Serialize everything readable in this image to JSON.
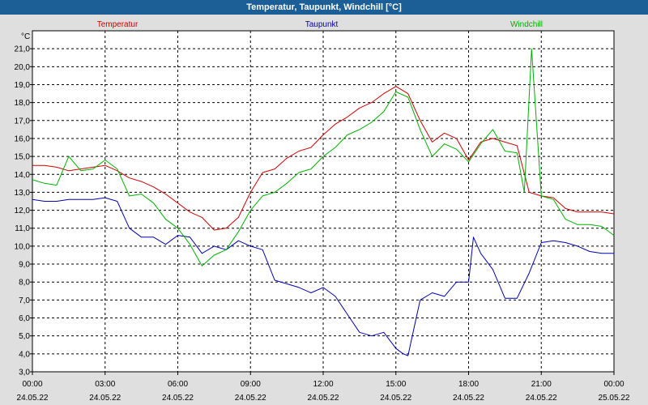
{
  "window": {
    "title": "Temperatur, Taupunkt, Windchill [°C]"
  },
  "chart_data": {
    "type": "line",
    "title": "Temperatur, Taupunkt, Windchill [°C]",
    "ylabel": "°C",
    "ylim": [
      3.0,
      22.0
    ],
    "xlim_hours": [
      0,
      24
    ],
    "grid": true,
    "y_ticks": [
      "3,0",
      "4,0",
      "5,0",
      "6,0",
      "7,0",
      "8,0",
      "9,0",
      "10,0",
      "11,0",
      "12,0",
      "13,0",
      "14,0",
      "15,0",
      "16,0",
      "17,0",
      "18,0",
      "19,0",
      "20,0",
      "21,0"
    ],
    "x_ticks": [
      {
        "time": "00:00",
        "date": "24.05.22"
      },
      {
        "time": "03:00",
        "date": "24.05.22"
      },
      {
        "time": "06:00",
        "date": "24.05.22"
      },
      {
        "time": "09:00",
        "date": "24.05.22"
      },
      {
        "time": "12:00",
        "date": "24.05.22"
      },
      {
        "time": "15:00",
        "date": "24.05.22"
      },
      {
        "time": "18:00",
        "date": "24.05.22"
      },
      {
        "time": "21:00",
        "date": "24.05.22"
      },
      {
        "time": "00:00",
        "date": "25.05.22"
      }
    ],
    "series": [
      {
        "name": "Temperatur",
        "color": "#cc0000",
        "x": [
          0,
          0.5,
          1,
          1.5,
          2,
          2.5,
          3,
          3.5,
          4,
          4.5,
          5,
          5.5,
          6,
          6.5,
          7,
          7.5,
          8,
          8.5,
          9,
          9.5,
          10,
          10.5,
          11,
          11.5,
          12,
          12.5,
          13,
          13.5,
          14,
          14.5,
          15,
          15.5,
          16,
          16.5,
          17,
          17.5,
          18,
          18.5,
          19,
          19.5,
          20,
          20.5,
          21,
          21.5,
          22,
          22.5,
          23,
          23.5,
          24
        ],
        "values": [
          14.5,
          14.5,
          14.4,
          14.2,
          14.3,
          14.4,
          14.5,
          14.2,
          13.8,
          13.6,
          13.3,
          12.9,
          12.4,
          11.9,
          11.6,
          10.9,
          11.0,
          11.6,
          13.0,
          14.1,
          14.3,
          14.9,
          15.3,
          15.5,
          16.2,
          16.8,
          17.2,
          17.7,
          18.0,
          18.5,
          18.9,
          18.5,
          17.0,
          15.8,
          16.3,
          16.0,
          14.8,
          15.8,
          16.0,
          15.8,
          15.6,
          13.0,
          12.8,
          12.7,
          12.1,
          11.9,
          11.9,
          11.9,
          11.8
        ]
      },
      {
        "name": "Taupunkt",
        "color": "#0000b0",
        "x": [
          0,
          0.5,
          1,
          1.5,
          2,
          2.5,
          3,
          3.5,
          4,
          4.5,
          5,
          5.5,
          6,
          6.5,
          7,
          7.5,
          8,
          8.5,
          9,
          9.5,
          10,
          10.5,
          11,
          11.5,
          12,
          12.5,
          13,
          13.5,
          14,
          14.5,
          15,
          15.3,
          15.5,
          16,
          16.5,
          17,
          17.5,
          18,
          18.2,
          18.5,
          19,
          19.5,
          20,
          20.5,
          21,
          21.5,
          22,
          22.5,
          23,
          23.5,
          24
        ],
        "values": [
          12.6,
          12.5,
          12.5,
          12.6,
          12.6,
          12.6,
          12.7,
          12.5,
          11.0,
          10.5,
          10.5,
          10.1,
          10.6,
          10.5,
          9.6,
          10.0,
          9.8,
          10.3,
          10.0,
          9.8,
          8.1,
          7.9,
          7.7,
          7.4,
          7.7,
          7.2,
          6.2,
          5.2,
          5.0,
          5.2,
          4.3,
          4.0,
          3.9,
          7.0,
          7.4,
          7.2,
          8.0,
          8.0,
          10.5,
          9.6,
          8.7,
          7.1,
          7.1,
          8.5,
          10.2,
          10.3,
          10.2,
          10.0,
          9.7,
          9.6,
          9.6
        ]
      },
      {
        "name": "Windchill",
        "color": "#00b000",
        "x": [
          0,
          0.5,
          1,
          1.5,
          2,
          2.5,
          3,
          3.5,
          4,
          4.5,
          5,
          5.5,
          6,
          6.5,
          7,
          7.5,
          8,
          8.5,
          9,
          9.5,
          10,
          10.5,
          11,
          11.5,
          12,
          12.5,
          13,
          13.5,
          14,
          14.5,
          15,
          15.5,
          16,
          16.5,
          17,
          17.5,
          18,
          18.5,
          19,
          19.5,
          20,
          20.3,
          20.6,
          21,
          21.5,
          22,
          22.5,
          23,
          23.5,
          24
        ],
        "values": [
          13.7,
          13.5,
          13.4,
          15.0,
          14.2,
          14.3,
          14.8,
          14.3,
          12.8,
          12.9,
          12.4,
          11.5,
          11.0,
          10.1,
          8.9,
          9.5,
          9.8,
          10.8,
          12.0,
          12.8,
          13.0,
          13.5,
          14.1,
          14.3,
          15.0,
          15.5,
          16.2,
          16.5,
          16.9,
          17.5,
          18.6,
          18.3,
          16.5,
          15.0,
          15.7,
          15.4,
          14.7,
          15.7,
          16.5,
          15.3,
          15.2,
          13.0,
          21.0,
          12.8,
          12.6,
          11.5,
          11.2,
          11.2,
          11.1,
          10.6
        ]
      }
    ]
  }
}
